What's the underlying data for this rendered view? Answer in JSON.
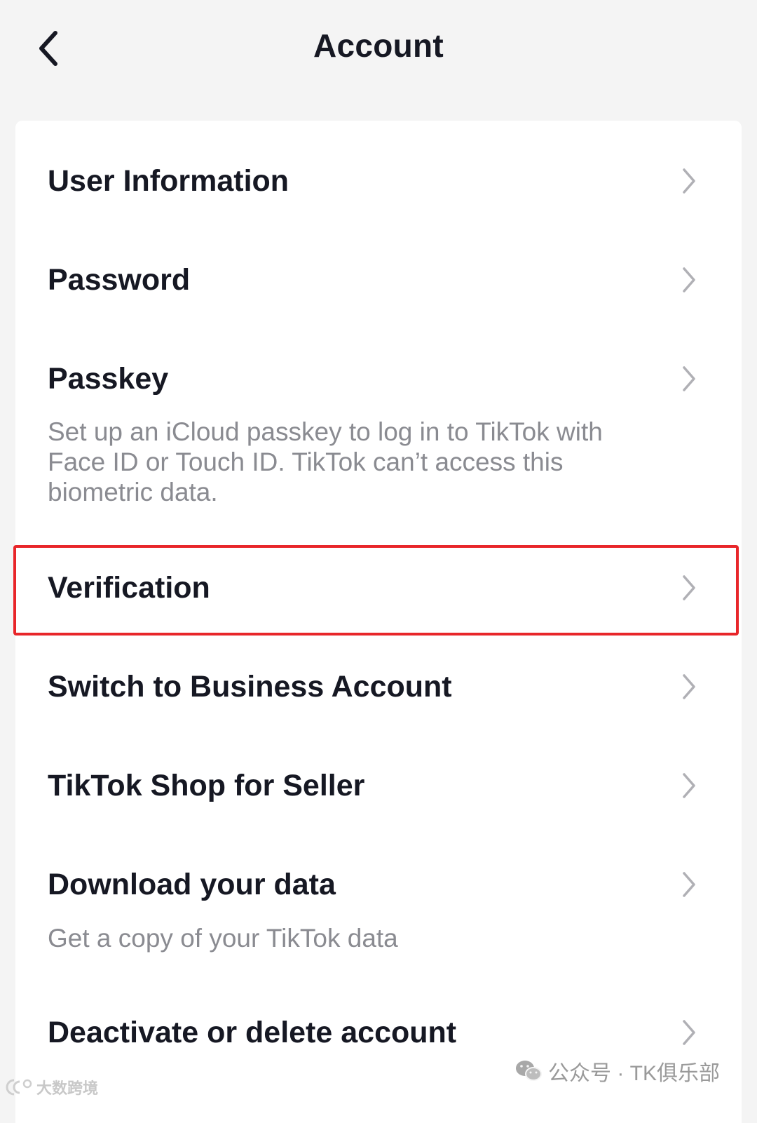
{
  "header": {
    "title": "Account",
    "back_icon": "chevron-left-icon"
  },
  "rows": [
    {
      "title": "User Information",
      "icon": "chevron-right-icon"
    },
    {
      "title": "Password",
      "icon": "chevron-right-icon"
    },
    {
      "title": "Passkey",
      "description": "Set up an iCloud passkey to log in to TikTok with Face ID or Touch ID. TikTok can’t access this biometric data.",
      "icon": "chevron-right-icon"
    },
    {
      "title": "Verification",
      "icon": "chevron-right-icon",
      "highlighted": true
    },
    {
      "title": "Switch to Business Account",
      "icon": "chevron-right-icon"
    },
    {
      "title": "TikTok Shop for Seller",
      "icon": "chevron-right-icon"
    },
    {
      "title": "Download your data",
      "description": "Get a copy of your TikTok data",
      "icon": "chevron-right-icon"
    },
    {
      "title": "Deactivate or delete account",
      "icon": "chevron-right-icon"
    }
  ],
  "watermarks": {
    "right": "公众号 · TK俱乐部",
    "left": "大数跨境"
  },
  "colors": {
    "background": "#f4f4f4",
    "card": "#ffffff",
    "title_text": "#161823",
    "secondary_text": "#8a8b91",
    "chevron": "#b0b0b5",
    "highlight": "#e8262a"
  }
}
